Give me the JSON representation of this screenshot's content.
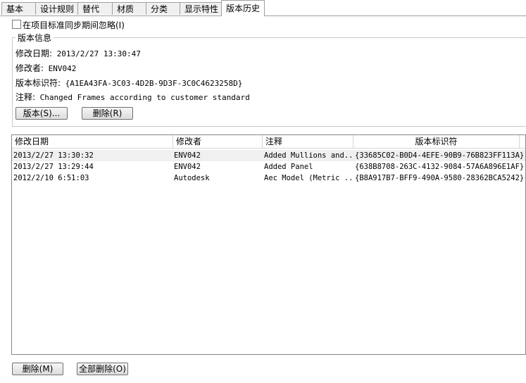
{
  "tabs": [
    "基本",
    "设计规则",
    "替代",
    "材质",
    "分类",
    "显示特性",
    "版本历史"
  ],
  "active_tab": "版本历史",
  "sync_checkbox": {
    "label": "在项目标准同步期间忽略(I)",
    "checked": false
  },
  "version_info": {
    "title": "版本信息",
    "modified_date_label": "修改日期:",
    "modified_date": "2013/2/27 13:30:47",
    "modifier_label": "修改者:",
    "modifier": "ENV042",
    "version_id_label": "版本标识符:",
    "version_id": "{A1EA43FA-3C03-4D2B-9D3F-3C0C4623258D}",
    "comment_label": "注释:",
    "comment": "Changed Frames according to customer standard",
    "version_button": "版本(S)...",
    "delete_button": "删除(R)"
  },
  "history_table": {
    "columns": [
      "修改日期",
      "修改者",
      "注释",
      "版本标识符"
    ],
    "rows": [
      {
        "date": "2013/2/27 13:30:32",
        "modifier": "ENV042",
        "comment": "Added Mullions and...",
        "id": "{33685C02-B0D4-4EFE-90B9-76B823FF113A}"
      },
      {
        "date": "2013/2/27 13:29:44",
        "modifier": "ENV042",
        "comment": "Added Panel",
        "id": "{638B8708-263C-4132-9084-57A6A896E1AF}"
      },
      {
        "date": "2012/2/10 6:51:03",
        "modifier": "Autodesk",
        "comment": "Aec Model (Metric ...",
        "id": "{B8A917B7-BFF9-490A-9580-28362BCA5242}"
      }
    ]
  },
  "bottom_buttons": {
    "delete": "删除(M)",
    "delete_all": "全部删除(O)"
  }
}
